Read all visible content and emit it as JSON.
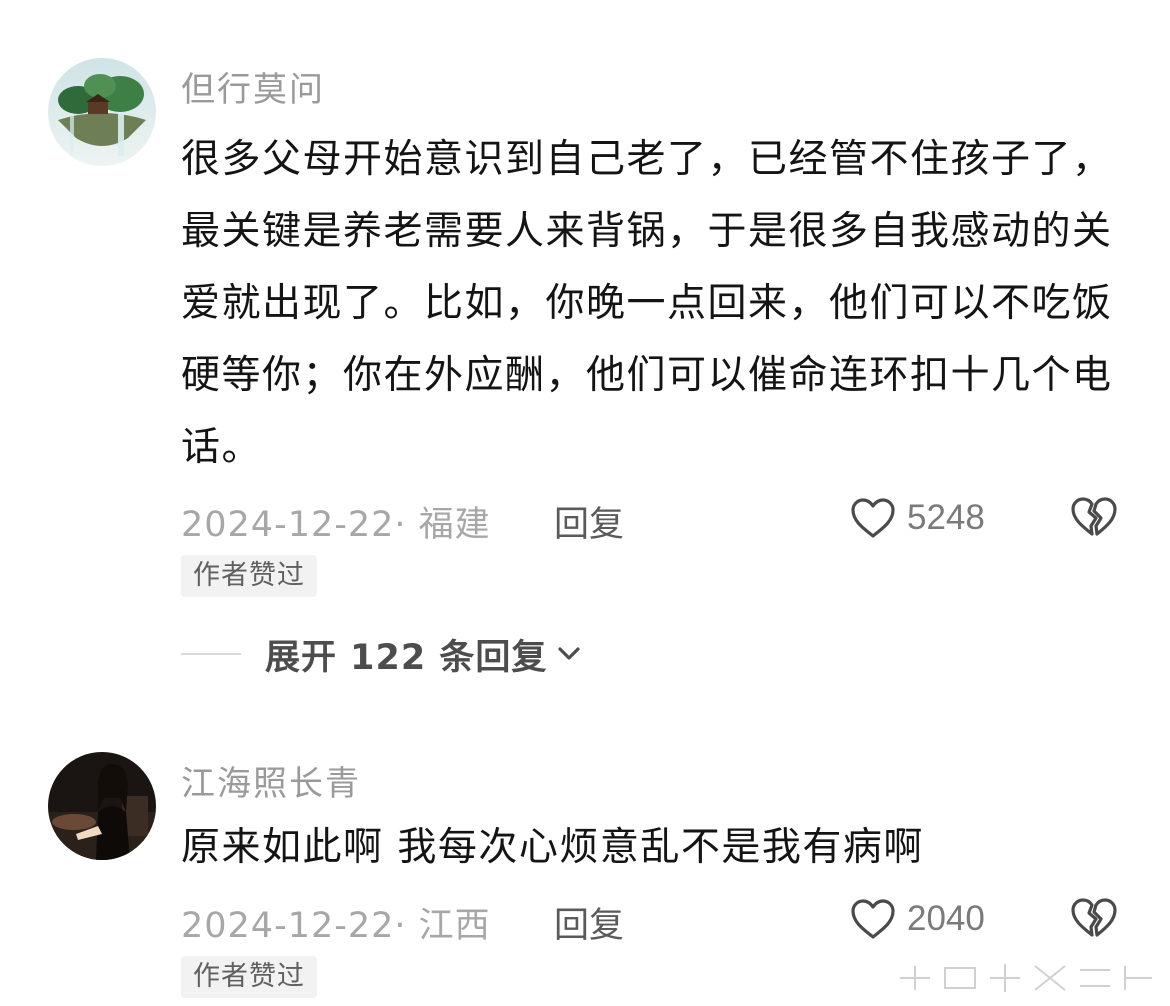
{
  "comments": [
    {
      "username": "但行莫问",
      "text": "很多父母开始意识到自己老了，已经管不住孩子了，最关键是养老需要人来背锅，于是很多自我感动的关爱就出现了。比如，你晚一点回来，他们可以不吃饭硬等你；你在外应酬，他们可以催命连环扣十几个电话。",
      "date_location": "2024-12-22· 福建",
      "reply_label": "回复",
      "likes": "5248",
      "badge": "作者赞过"
    },
    {
      "username": "江海照长青",
      "text": "原来如此啊 我每次心烦意乱不是我有病啊",
      "date_location": "2024-12-22· 江西",
      "reply_label": "回复",
      "likes": "2040",
      "badge": "作者赞过"
    }
  ],
  "expand": {
    "label": "展开 122 条回复"
  },
  "icons": {
    "like": "heart-outline-icon",
    "dislike": "broken-heart-icon",
    "expand": "chevron-down-icon"
  },
  "colors": {
    "username": "#9a9a9a",
    "body": "#141414",
    "meta": "#a7a7a7",
    "badge_bg": "#f2f2f2"
  }
}
